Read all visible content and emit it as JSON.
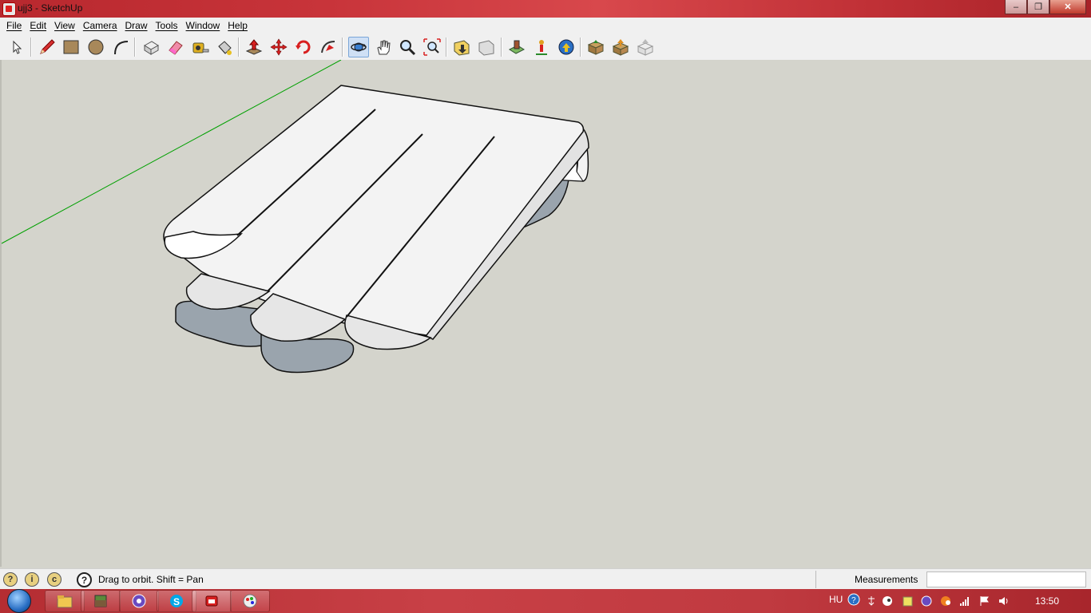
{
  "window": {
    "title": "ujj3 - SketchUp"
  },
  "menu": [
    "File",
    "Edit",
    "View",
    "Camera",
    "Draw",
    "Tools",
    "Window",
    "Help"
  ],
  "toolbar": {
    "tools": [
      "select",
      "pencil",
      "rectangle",
      "circle",
      "arc",
      "make-component",
      "eraser",
      "tape-measure",
      "paint-bucket",
      "push-pull",
      "move",
      "rotate",
      "follow-me",
      "orbit",
      "pan",
      "zoom",
      "zoom-extents",
      "previous-view",
      "next-view",
      "add-location",
      "position-camera",
      "walk",
      "get-models",
      "share-model",
      "share-component"
    ],
    "active_tool": "orbit"
  },
  "status": {
    "hint": "Drag to orbit.  Shift = Pan",
    "measurements_label": "Measurements",
    "measurements_value": ""
  },
  "taskbar": {
    "apps": [
      "explorer",
      "minecraft",
      "cortana-app",
      "skype",
      "sketchup",
      "paint"
    ],
    "active_app": "sketchup",
    "language": "HU",
    "clock": "13:50"
  },
  "colors": {
    "viewport_bg": "#d4d4cc",
    "model_face_front": "#f3f3f3",
    "model_face_back": "#98a2ab",
    "axis_green": "#00a000"
  }
}
